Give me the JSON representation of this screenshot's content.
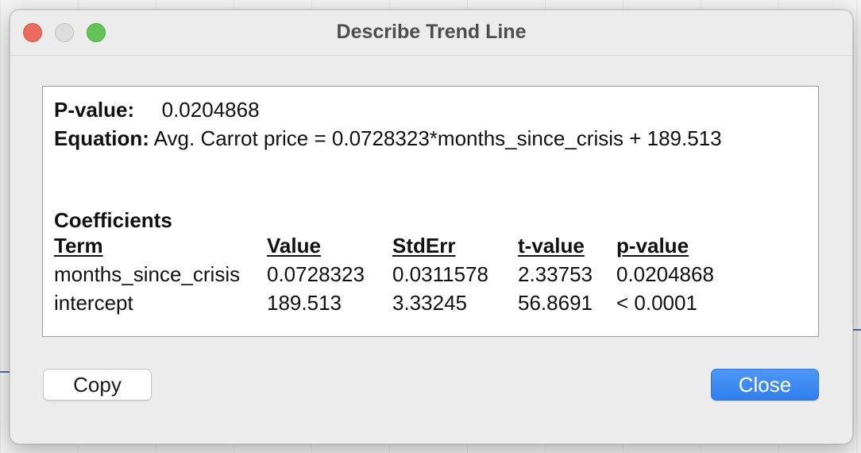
{
  "window": {
    "title": "Describe Trend Line"
  },
  "summary": {
    "pvalue_label": "P-value:",
    "pvalue": "0.0204868",
    "equation_label": "Equation:",
    "equation": "Avg. Carrot price = 0.0728323*months_since_crisis + 189.513"
  },
  "coefficients": {
    "heading": "Coefficients",
    "headers": [
      "Term",
      "Value",
      "StdErr",
      "t-value",
      "p-value"
    ],
    "rows": [
      [
        "months_since_crisis",
        "0.0728323",
        "0.0311578",
        "2.33753",
        "0.0204868"
      ],
      [
        "intercept",
        "189.513",
        "3.33245",
        "56.8691",
        "< 0.0001"
      ]
    ]
  },
  "buttons": {
    "copy": "Copy",
    "close": "Close"
  },
  "colors": {
    "accent": "#2f7ff0",
    "close_traffic": "#ed6a5e",
    "max_traffic": "#61c454"
  }
}
